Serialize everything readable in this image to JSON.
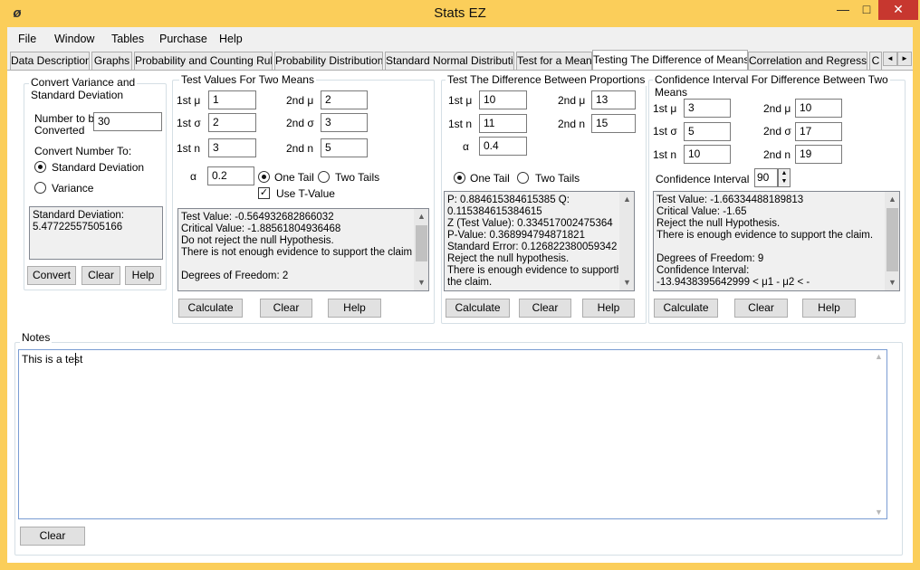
{
  "window": {
    "title": "Stats EZ",
    "app_icon": "app-icon",
    "min": "—",
    "max": "□",
    "close": "✕"
  },
  "menu": [
    "File",
    "Window",
    "Tables",
    "Purchase",
    "Help"
  ],
  "tabs": [
    "Data Description",
    "Graphs",
    "Probability and Counting Rules",
    "Probability Distributions",
    "Standard Normal Distribution",
    "Test for a Mean",
    "Testing The Difference of Means",
    "Correlation and Regression",
    "C"
  ],
  "active_tab": 6,
  "tab_scroll": {
    "left": "◄",
    "right": "►"
  },
  "convert": {
    "title": "Convert Variance and Standard Deviation",
    "title_line1": "Convert Variance and",
    "title_line2": "Standard Deviation",
    "number_label_line1": "Number to be",
    "number_label_line2": "Converted",
    "number_value": "30",
    "convert_to_label": "Convert Number To:",
    "opt_sd": "Standard Deviation",
    "opt_var": "Variance",
    "selected": "Standard Deviation",
    "result": [
      "Standard Deviation:",
      "5.47722557505166"
    ],
    "buttons": {
      "convert": "Convert",
      "clear": "Clear",
      "help": "Help"
    }
  },
  "two_means": {
    "title": "Test Values For Two Means",
    "mu1_label": "1st μ",
    "mu1": "1",
    "mu2_label": "2nd μ",
    "mu2": "2",
    "sd1_label": "1st σ",
    "sd1": "2",
    "sd2_label": "2nd σ",
    "sd2": "3",
    "n1_label": "1st n",
    "n1": "3",
    "n2_label": "2nd n",
    "n2": "5",
    "alpha_label": "α",
    "alpha": "0.2",
    "one_tail": "One Tail",
    "two_tails": "Two Tails",
    "tail_selected": "One Tail",
    "use_t": "Use T-Value",
    "use_t_checked": true,
    "result": [
      "Test Value: -0.564932682866032",
      "Critical Value: -1.88561804936468",
      "Do not reject the null Hypothesis.",
      "There is not enough evidence to support the claim.",
      "",
      "Degrees of Freedom: 2"
    ],
    "buttons": {
      "calculate": "Calculate",
      "clear": "Clear",
      "help": "Help"
    }
  },
  "proportions": {
    "title": "Test The Difference Between Proportions",
    "mu1_label": "1st μ",
    "mu1": "10",
    "mu2_label": "2nd μ",
    "mu2": "13",
    "n1_label": "1st n",
    "n1": "11",
    "n2_label": "2nd n",
    "n2": "15",
    "alpha_label": "α",
    "alpha": "0.4",
    "one_tail": "One Tail",
    "two_tails": "Two Tails",
    "tail_selected": "One Tail",
    "result": [
      "P: 0.884615384615385  Q:",
      "0.115384615384615",
      "Z (Test Value): 0.334517002475364",
      "P-Value: 0.368994794871821",
      "Standard Error: 0.126822380059342",
      "Reject the null hypothesis.",
      "There is enough evidence to supporth",
      "the claim."
    ],
    "buttons": {
      "calculate": "Calculate",
      "clear": "Clear",
      "help": "Help"
    }
  },
  "confidence": {
    "title_line1": "Confidence Interval For Difference Between Two",
    "title_line2": "Means",
    "mu1_label": "1st μ",
    "mu1": "3",
    "mu2_label": "2nd μ",
    "mu2": "10",
    "sd1_label": "1st σ",
    "sd1": "5",
    "sd2_label": "2nd σ",
    "sd2": "17",
    "n1_label": "1st n",
    "n1": "10",
    "n2_label": "2nd n",
    "n2": "19",
    "ci_label": "Confidence Interval",
    "ci_value": "90",
    "result": [
      "Test Value: -1.66334488189813",
      "Critical Value: -1.65",
      "Reject the null Hypothesis.",
      "There is enough evidence to support the claim.",
      "",
      "Degrees of Freedom: 9",
      "Confidence Interval:",
      "-13.9438395642999 < μ1 - μ2 < -"
    ],
    "buttons": {
      "calculate": "Calculate",
      "clear": "Clear",
      "help": "Help"
    }
  },
  "notes": {
    "title": "Notes",
    "text": "This is a test",
    "clear": "Clear"
  },
  "scroll": {
    "up": "▲",
    "down": "▼",
    "spin_up": "▲",
    "spin_down": "▼"
  },
  "colors": {
    "titlebar": "#fbce5a",
    "close": "#c7372f",
    "panel": "#ffffff",
    "result_bg": "#f0f0f0",
    "notes_border": "#7a9cd3"
  }
}
